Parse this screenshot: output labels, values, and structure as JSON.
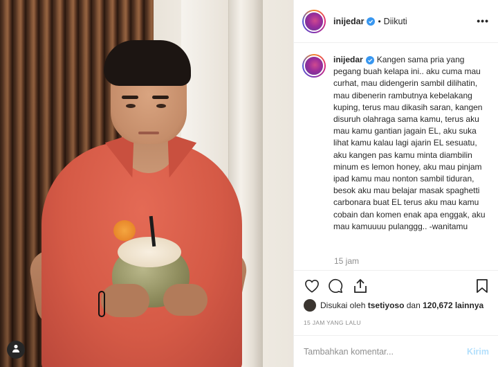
{
  "header": {
    "username": "inijedar",
    "separator": "•",
    "follow_status": "Diikuti",
    "more_label": "•••"
  },
  "post": {
    "caption_username": "inijedar",
    "caption_text": "Kangen sama pria yang pegang buah kelapa ini.. aku cuma mau curhat, mau didengerin sambil dilihatin, mau dibenerin rambutnya kebelakang kuping, terus mau dikasih saran, kangen disuruh olahraga sama kamu, terus aku mau kamu gantian jagain EL, aku suka lihat kamu kalau lagi ajarin EL sesuatu, aku kangen pas kamu minta diambilin minum es lemon honey, aku mau pinjam ipad kamu mau nonton sambil tiduran, besok aku mau belajar masak spaghetti carbonara buat EL terus aku mau kamu cobain dan komen enak apa enggak, aku mau kamuuuu pulanggg.. -wanitamu",
    "time": "15 jam"
  },
  "likes": {
    "prefix": "Disukai oleh",
    "user": "tsetiyoso",
    "middle": "dan",
    "count": "120,672 lainnya"
  },
  "ago": "15 JAM YANG LALU",
  "comment": {
    "placeholder": "Tambahkan komentar...",
    "send_label": "Kirim"
  },
  "icons": {
    "verified": "verified-badge-icon",
    "like": "heart-icon",
    "comment": "comment-bubble-icon",
    "share": "share-icon",
    "save": "bookmark-icon",
    "user": "user-icon"
  },
  "colors": {
    "verified_blue": "#3897f0",
    "muted": "#8e8e8e",
    "send_disabled": "#b2dffc",
    "shirt_coral": "#d55a46"
  }
}
